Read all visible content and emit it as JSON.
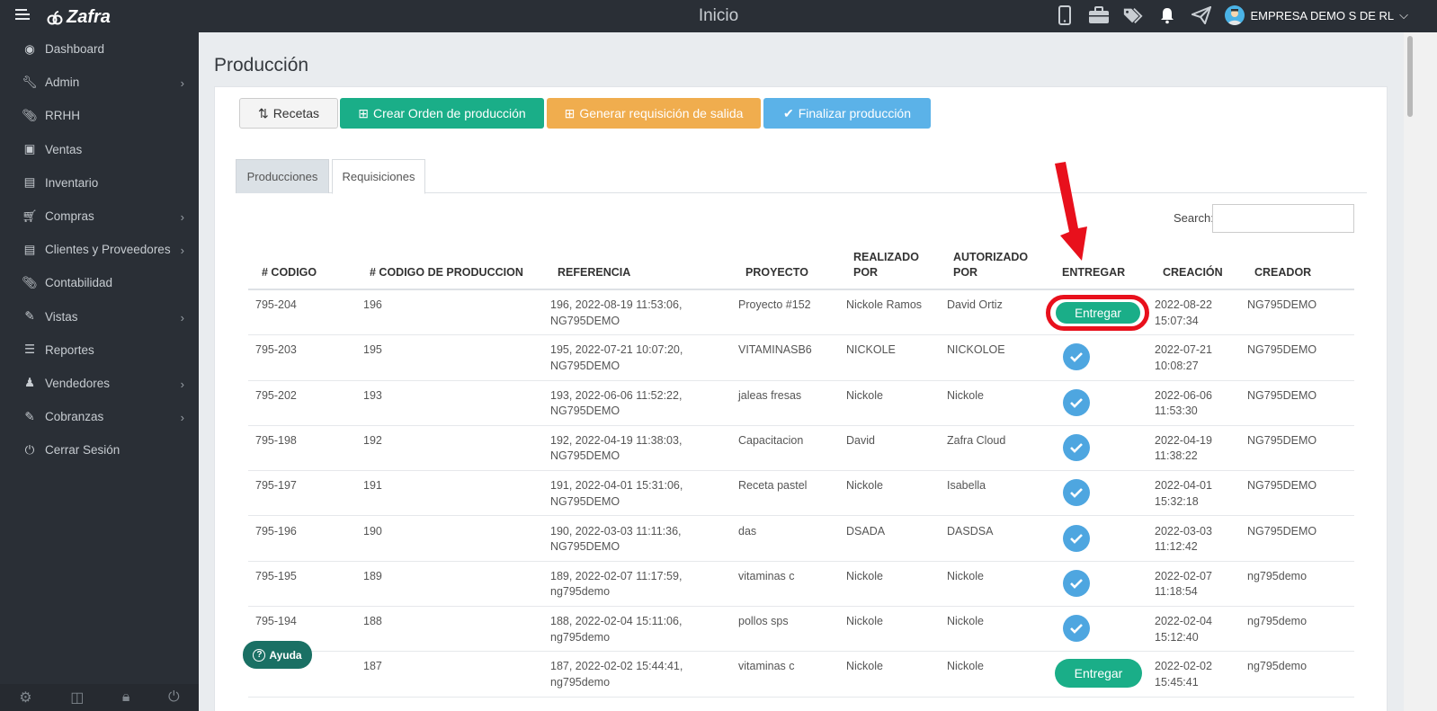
{
  "app": {
    "brand": "Zafra",
    "top_title": "Inicio",
    "company": "EMPRESA DEMO S DE RL"
  },
  "sidebar": {
    "items": [
      {
        "label": "Dashboard",
        "icon": "dashboard-icon",
        "has_submenu": false
      },
      {
        "label": "Admin",
        "icon": "wrench-icon",
        "has_submenu": true
      },
      {
        "label": "RRHH",
        "icon": "paperclip-icon",
        "has_submenu": false
      },
      {
        "label": "Ventas",
        "icon": "money-icon",
        "has_submenu": false
      },
      {
        "label": "Inventario",
        "icon": "book-icon",
        "has_submenu": false
      },
      {
        "label": "Compras",
        "icon": "cart-icon",
        "has_submenu": true
      },
      {
        "label": "Clientes y Proveedores",
        "icon": "book-icon",
        "has_submenu": true
      },
      {
        "label": "Contabilidad",
        "icon": "paperclip-icon",
        "has_submenu": false
      },
      {
        "label": "Vistas",
        "icon": "edit-icon",
        "has_submenu": true
      },
      {
        "label": "Reportes",
        "icon": "list-icon",
        "has_submenu": false
      },
      {
        "label": "Vendedores",
        "icon": "user-icon",
        "has_submenu": true
      },
      {
        "label": "Cobranzas",
        "icon": "edit-icon",
        "has_submenu": true
      },
      {
        "label": "Cerrar Sesión",
        "icon": "power-icon",
        "has_submenu": false
      }
    ]
  },
  "main": {
    "page_title": "Producción",
    "buttons": {
      "recetas": "Recetas",
      "crear": "Crear Orden de producción",
      "generar": "Generar requisición de salida",
      "finalizar": "Finalizar producción"
    },
    "tabs": [
      "Producciones",
      "Requisiciones"
    ],
    "active_tab": "Requisiciones",
    "search_label": "Search:",
    "search_value": "",
    "help_label": "Ayuda"
  },
  "table": {
    "headers": {
      "codigo": "# CODIGO",
      "codigo_produccion": "# CODIGO DE PRODUCCION",
      "referencia": "REFERENCIA",
      "proyecto": "PROYECTO",
      "realizado_1": "REALIZADO",
      "realizado_2": "POR",
      "autorizado_1": "AUTORIZADO",
      "autorizado_2": "POR",
      "entregar": "ENTREGAR",
      "creacion": "CREACIÓN",
      "creador": "CREADOR"
    },
    "entregar_label": "Entregar",
    "rows": [
      {
        "codigo": "795-204",
        "prod": "196",
        "ref1": "196, 2022-08-19 11:53:06,",
        "ref2": "NG795DEMO",
        "proyecto": "Proyecto #152",
        "realizado": "Nickole Ramos",
        "autorizado": "David Ortiz",
        "status": "pending",
        "fecha": "2022-08-22",
        "hora": "15:07:34",
        "creador": "NG795DEMO"
      },
      {
        "codigo": "795-203",
        "prod": "195",
        "ref1": "195, 2022-07-21 10:07:20,",
        "ref2": "NG795DEMO",
        "proyecto": "VITAMINASB6",
        "realizado": "NICKOLE",
        "autorizado": "NICKOLOE",
        "status": "delivered",
        "fecha": "2022-07-21",
        "hora": "10:08:27",
        "creador": "NG795DEMO"
      },
      {
        "codigo": "795-202",
        "prod": "193",
        "ref1": "193, 2022-06-06 11:52:22,",
        "ref2": "NG795DEMO",
        "proyecto": "jaleas fresas",
        "realizado": "Nickole",
        "autorizado": "Nickole",
        "status": "delivered",
        "fecha": "2022-06-06",
        "hora": "11:53:30",
        "creador": "NG795DEMO"
      },
      {
        "codigo": "795-198",
        "prod": "192",
        "ref1": "192, 2022-04-19 11:38:03,",
        "ref2": "NG795DEMO",
        "proyecto": "Capacitacion",
        "realizado": "David",
        "autorizado": "Zafra Cloud",
        "status": "delivered",
        "fecha": "2022-04-19",
        "hora": "11:38:22",
        "creador": "NG795DEMO"
      },
      {
        "codigo": "795-197",
        "prod": "191",
        "ref1": "191, 2022-04-01 15:31:06,",
        "ref2": "NG795DEMO",
        "proyecto": "Receta pastel",
        "realizado": "Nickole",
        "autorizado": "Isabella",
        "status": "delivered",
        "fecha": "2022-04-01",
        "hora": "15:32:18",
        "creador": "NG795DEMO"
      },
      {
        "codigo": "795-196",
        "prod": "190",
        "ref1": "190, 2022-03-03 11:11:36,",
        "ref2": "NG795DEMO",
        "proyecto": "das",
        "realizado": "DSADA",
        "autorizado": "DASDSA",
        "status": "delivered",
        "fecha": "2022-03-03",
        "hora": "11:12:42",
        "creador": "NG795DEMO"
      },
      {
        "codigo": "795-195",
        "prod": "189",
        "ref1": "189, 2022-02-07 11:17:59,",
        "ref2": "ng795demo",
        "proyecto": "vitaminas c",
        "realizado": "Nickole",
        "autorizado": "Nickole",
        "status": "delivered",
        "fecha": "2022-02-07",
        "hora": "11:18:54",
        "creador": "ng795demo"
      },
      {
        "codigo": "795-194",
        "prod": "188",
        "ref1": "188, 2022-02-04 15:11:06,",
        "ref2": "ng795demo",
        "proyecto": "pollos sps",
        "realizado": "Nickole",
        "autorizado": "Nickole",
        "status": "delivered",
        "fecha": "2022-02-04",
        "hora": "15:12:40",
        "creador": "ng795demo"
      },
      {
        "codigo": "",
        "prod": "187",
        "ref1": "187, 2022-02-02 15:44:41,",
        "ref2": "ng795demo",
        "proyecto": "vitaminas c",
        "realizado": "Nickole",
        "autorizado": "Nickole",
        "status": "pending",
        "fecha": "2022-02-02",
        "hora": "15:45:41",
        "creador": "ng795demo"
      }
    ]
  },
  "colors": {
    "sidebar_bg": "#2a2f36",
    "success": "#1aae88",
    "warning": "#f0ad4e",
    "info": "#5bb2e8",
    "check": "#4ea6e0",
    "annotation_red": "#e8101c"
  }
}
